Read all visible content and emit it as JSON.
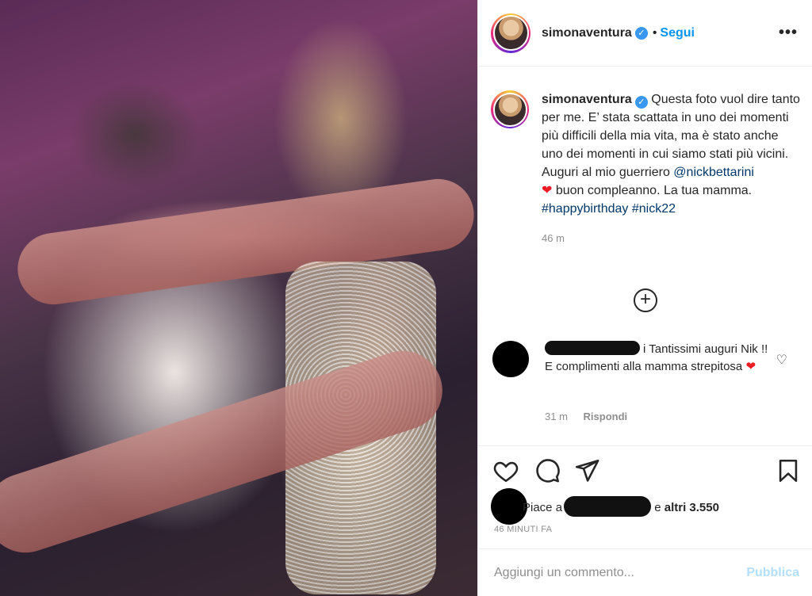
{
  "post": {
    "username": "simonaventura",
    "verified_icon": "verified-badge-icon",
    "follow_label": "Segui",
    "separator": "•",
    "more_label": "•••"
  },
  "caption": {
    "username": "simonaventura",
    "text_1": "Questa foto vuol dire tanto per me. E’ stata scattata in uno dei momenti più difficili della mia vita, ma è stato anche uno dei momenti in cui siamo stati più vicini. Auguri al mio guerriero ",
    "mention": "@nickbettarini",
    "heart": "❤",
    "text_2": " buon compleanno. La tua mamma.",
    "hashtag_1": "#happybirthday",
    "hashtag_2": "#nick22",
    "time": "46 m"
  },
  "load_more_icon": "+",
  "comment": {
    "text_suffix": "i Tantissimi auguri Nik !! E complimenti alla mamma strepitosa",
    "heart": "❤",
    "like_icon": "♡",
    "time": "31 m",
    "reply_label": "Rispondi"
  },
  "likes": {
    "prefix": "Piace a",
    "suffix": "e",
    "others": "altri 3.550"
  },
  "posted_ago": "46 MINUTI FA",
  "add_comment": {
    "placeholder": "Aggiungi un commento...",
    "publish_label": "Pubblica"
  },
  "colors": {
    "accent": "#0095f6",
    "publish_disabled": "#b2dffc",
    "heart_red": "#ed1c24",
    "link": "#00376b"
  }
}
